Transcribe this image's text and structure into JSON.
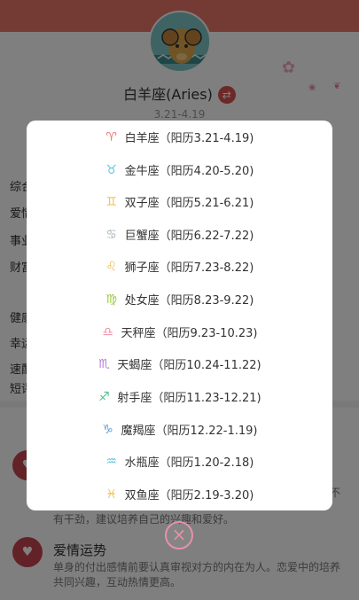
{
  "header": {
    "sign_name": "白羊座(Aries)",
    "date_range": "3.21-4.19",
    "switch_glyph": "⇄"
  },
  "sidebar_labels": [
    "综合",
    "爱情",
    "事业",
    "财富",
    "健康",
    "幸运",
    "速配",
    "短评"
  ],
  "sections": {
    "partial_text": "有干劲，建议培养自己的兴趣和爱好。",
    "partial_text_right": "不",
    "love_title": "爱情运势",
    "love_text": "单身的付出感情前要认真审视对方的内在为人。恋爱中的培养共同兴趣，互动热情更高。"
  },
  "zodiac_list": [
    {
      "icon": "♈",
      "color": "#e8776b",
      "label": "白羊座（阳历3.21-4.19)"
    },
    {
      "icon": "♉",
      "color": "#5fc4d9",
      "label": "金牛座（阳历4.20-5.20)"
    },
    {
      "icon": "♊",
      "color": "#f0c04a",
      "label": "双子座（阳历5.21-6.21)"
    },
    {
      "icon": "♋",
      "color": "#a9b4bd",
      "label": "巨蟹座（阳历6.22-7.22)"
    },
    {
      "icon": "♌",
      "color": "#f0c04a",
      "label": "狮子座（阳历7.23-8.22)"
    },
    {
      "icon": "♍",
      "color": "#9ccc3a",
      "label": "处女座（阳历8.23-9.22)"
    },
    {
      "icon": "♎",
      "color": "#f08aa5",
      "label": "天秤座（阳历9.23-10.23)"
    },
    {
      "icon": "♏",
      "color": "#b57bd6",
      "label": "天蝎座（阳历10.24-11.22)"
    },
    {
      "icon": "♐",
      "color": "#4fc08d",
      "label": "射手座（阳历11.23-12.21)"
    },
    {
      "icon": "♑",
      "color": "#5fa0d9",
      "label": "魔羯座（阳历12.22-1.19)"
    },
    {
      "icon": "♒",
      "color": "#5fc4d9",
      "label": "水瓶座（阳历1.20-2.18)"
    },
    {
      "icon": "♓",
      "color": "#f0c04a",
      "label": "双鱼座（阳历2.19-3.20)"
    }
  ],
  "close_glyph": "×"
}
